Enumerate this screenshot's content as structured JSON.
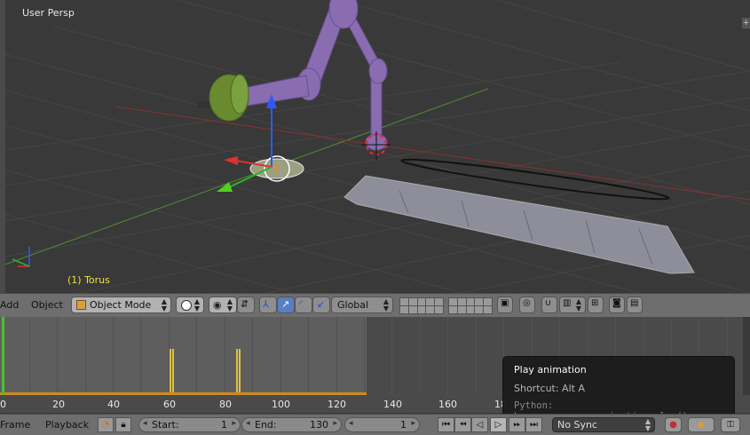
{
  "viewport": {
    "view_name": "User Persp",
    "object_name": "(1) Torus"
  },
  "header3d": {
    "menu_add": "Add",
    "menu_object": "Object",
    "mode": "Object Mode",
    "orientation": "Global"
  },
  "timeline": {
    "frame_labels": [
      "0",
      "20",
      "40",
      "60",
      "80",
      "100",
      "120",
      "140",
      "160",
      "18"
    ],
    "current_frame": 0,
    "keyframes": [
      60,
      84
    ],
    "range_end": 130
  },
  "tooltip": {
    "title": "Play animation",
    "shortcut": "Shortcut: Alt A",
    "python": "Python: bpy.ops.screen.animation_play()"
  },
  "footer": {
    "menu_frame": "Frame",
    "menu_playback": "Playback",
    "start_label": "Start:",
    "start_value": "1",
    "end_label": "End:",
    "end_value": "130",
    "current_value": "1",
    "sync": "No Sync"
  },
  "colors": {
    "viewport_bg": "#393939",
    "header_bg": "#6e6e6e",
    "accent_blue": "#5680c2",
    "keyframe": "#e0c040",
    "playhead": "#4fbf30",
    "object_label": "#f0e040"
  }
}
